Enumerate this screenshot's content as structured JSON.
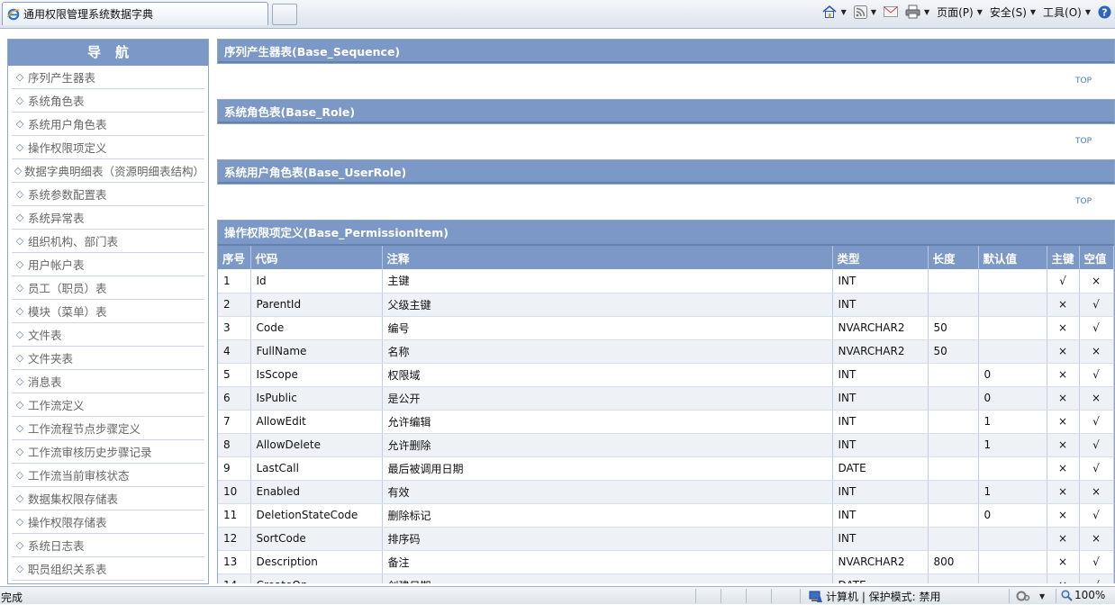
{
  "browser": {
    "tab_title": "通用权限管理系统数据字典",
    "commands": {
      "page": "页面(P)",
      "safety": "安全(S)",
      "tools": "工具(O)"
    }
  },
  "nav": {
    "title": "导航",
    "items": [
      "序列产生器表",
      "系统角色表",
      "系统用户角色表",
      "操作权限项定义",
      "数据字典明细表（资源明细表结构）",
      "系统参数配置表",
      "系统异常表",
      "组织机构、部门表",
      "用户帐户表",
      "员工（职员）表",
      "模块（菜单）表",
      "文件表",
      "文件夹表",
      "消息表",
      "工作流定义",
      "工作流程节点步骤定义",
      "工作流审核历史步骤记录",
      "工作流当前审核状态",
      "数据集权限存储表",
      "操作权限存储表",
      "系统日志表",
      "职员组织关系表"
    ]
  },
  "sections": [
    {
      "title": "序列产生器表(Base_Sequence)",
      "top": "TOP"
    },
    {
      "title": "系统角色表(Base_Role)",
      "top": "TOP"
    },
    {
      "title": "系统用户角色表(Base_UserRole)",
      "top": "TOP"
    }
  ],
  "table": {
    "title": "操作权限项定义(Base_PermissionItem)",
    "columns": [
      "序号",
      "代码",
      "注释",
      "类型",
      "长度",
      "默认值",
      "主键",
      "空值"
    ],
    "rows": [
      [
        "1",
        "Id",
        "主键",
        "INT",
        "",
        "",
        "√",
        "×"
      ],
      [
        "2",
        "ParentId",
        "父级主键",
        "INT",
        "",
        "",
        "×",
        "√"
      ],
      [
        "3",
        "Code",
        "编号",
        "NVARCHAR2",
        "50",
        "",
        "×",
        "√"
      ],
      [
        "4",
        "FullName",
        "名称",
        "NVARCHAR2",
        "50",
        "",
        "×",
        "×"
      ],
      [
        "5",
        "IsScope",
        "权限域",
        "INT",
        "",
        "0",
        "×",
        "√"
      ],
      [
        "6",
        "IsPublic",
        "是公开",
        "INT",
        "",
        "0",
        "×",
        "×"
      ],
      [
        "7",
        "AllowEdit",
        "允许编辑",
        "INT",
        "",
        "1",
        "×",
        "√"
      ],
      [
        "8",
        "AllowDelete",
        "允许删除",
        "INT",
        "",
        "1",
        "×",
        "√"
      ],
      [
        "9",
        "LastCall",
        "最后被调用日期",
        "DATE",
        "",
        "",
        "×",
        "√"
      ],
      [
        "10",
        "Enabled",
        "有效",
        "INT",
        "",
        "1",
        "×",
        "×"
      ],
      [
        "11",
        "DeletionStateCode",
        "删除标记",
        "INT",
        "",
        "0",
        "×",
        "√"
      ],
      [
        "12",
        "SortCode",
        "排序码",
        "INT",
        "",
        "",
        "×",
        "×"
      ],
      [
        "13",
        "Description",
        "备注",
        "NVARCHAR2",
        "800",
        "",
        "×",
        "√"
      ],
      [
        "14",
        "CreateOn",
        "创建日期",
        "DATE",
        "",
        "",
        "×",
        "√"
      ]
    ]
  },
  "status": {
    "left": "完成",
    "zone": "计算机 | 保护模式: 禁用",
    "zoom": "100%"
  },
  "colors": {
    "header_blue": "#7b98c6",
    "row_alt": "#eef1f6",
    "top_link": "#4a7ac4"
  }
}
